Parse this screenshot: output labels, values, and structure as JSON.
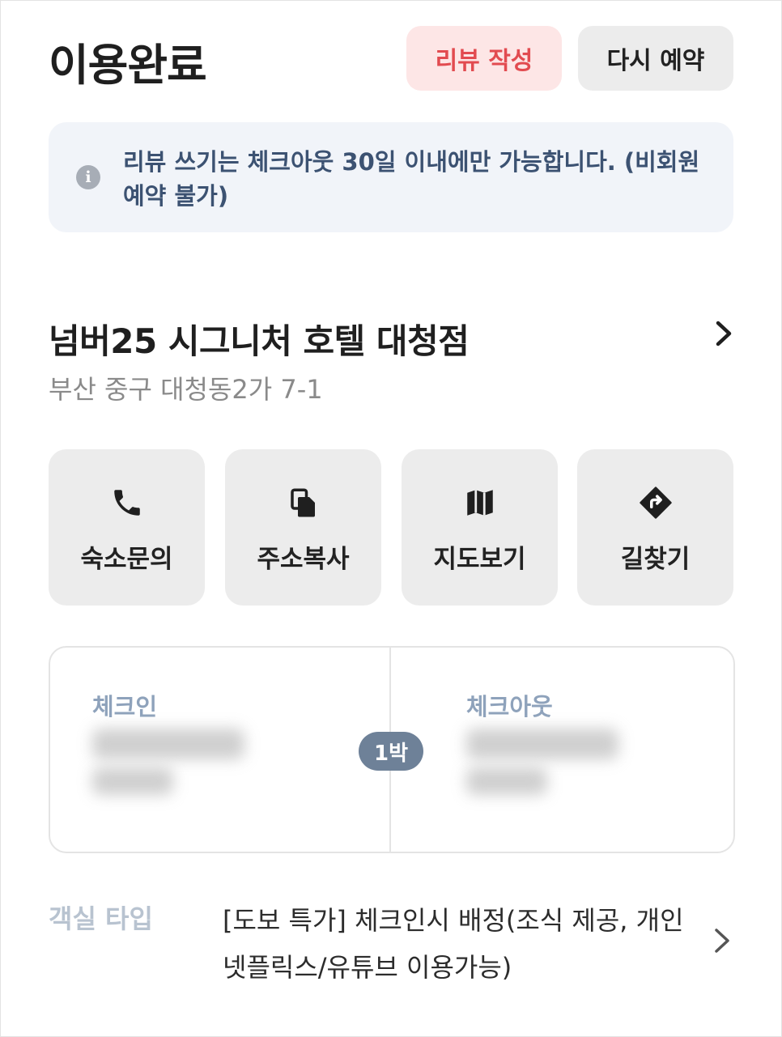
{
  "header": {
    "title": "이용완료",
    "review_button": "리뷰 작성",
    "rebook_button": "다시 예약"
  },
  "notice": {
    "icon": "info-icon",
    "text": "리뷰 쓰기는 체크아웃 30일 이내에만 가능합니다. (비회원 예약 불가)"
  },
  "hotel": {
    "name": "넘버25 시그니처 호텔 대청점",
    "address": "부산 중구 대청동2가 7-1"
  },
  "actions": [
    {
      "label": "숙소문의",
      "icon": "phone-icon"
    },
    {
      "label": "주소복사",
      "icon": "copy-icon"
    },
    {
      "label": "지도보기",
      "icon": "map-icon"
    },
    {
      "label": "길찾기",
      "icon": "directions-icon"
    }
  ],
  "stay": {
    "checkin_label": "체크인",
    "checkout_label": "체크아웃",
    "nights": "1박"
  },
  "room": {
    "label": "객실 타입",
    "value": "[도보 특가] 체크인시 배정(조식 제공, 개인 넷플릭스/유튜브 이용가능)"
  },
  "colors": {
    "accent_red": "#e24b50",
    "notice_bg": "#f1f4f9",
    "notice_text": "#3c5272",
    "badge_bg": "#6e8198"
  }
}
